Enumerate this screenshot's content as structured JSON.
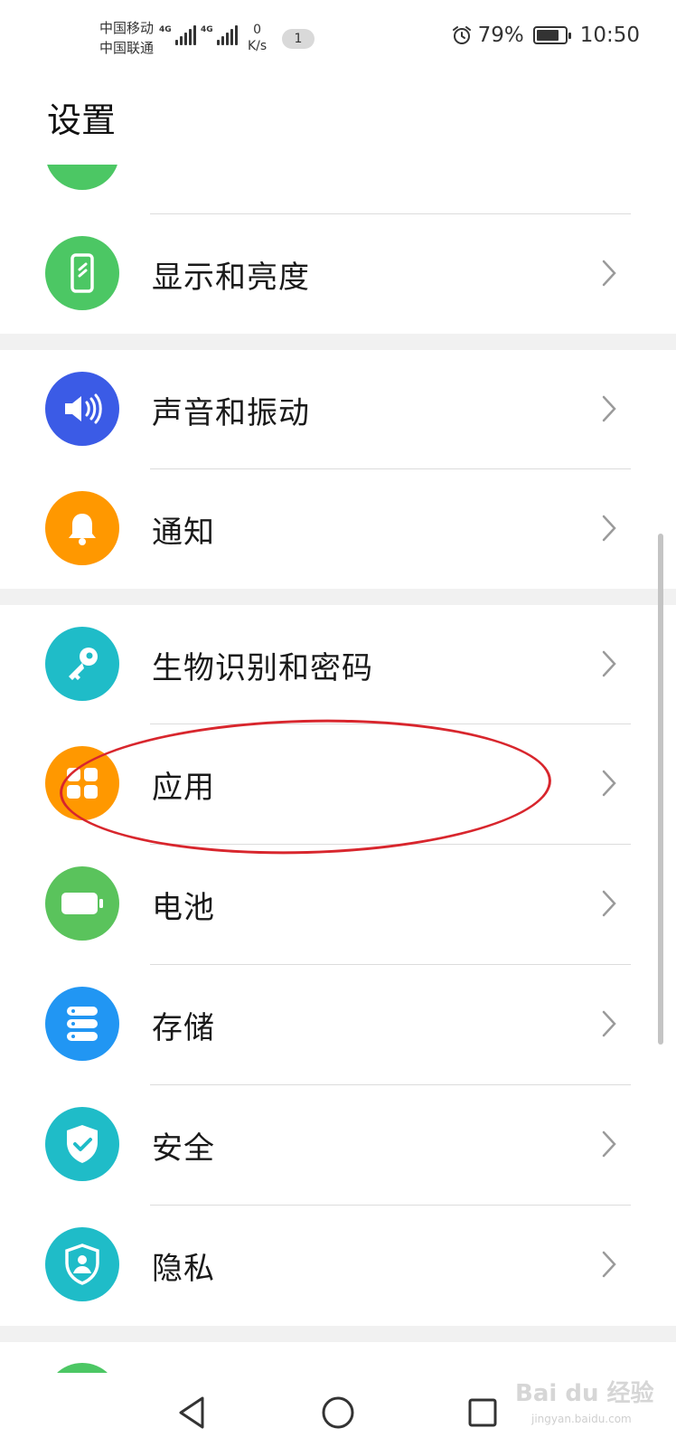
{
  "status_bar": {
    "carrier_1": "中国移动",
    "carrier_2": "中国联通",
    "network_1": "4G",
    "network_2": "4G",
    "speed_value": "0",
    "speed_unit": "K/s",
    "notification_count": "1",
    "battery_percent": "79%",
    "battery_level": 0.79,
    "time": "10:50"
  },
  "header": {
    "title": "设置"
  },
  "settings": {
    "items": [
      {
        "label": "显示和亮度",
        "icon": "display-icon",
        "color": "#4cc764"
      },
      {
        "label": "声音和振动",
        "icon": "speaker-icon",
        "color": "#3b5be6"
      },
      {
        "label": "通知",
        "icon": "bell-icon",
        "color": "#ff9800"
      },
      {
        "label": "生物识别和密码",
        "icon": "key-icon",
        "color": "#1fbcc8"
      },
      {
        "label": "应用",
        "icon": "apps-grid-icon",
        "color": "#ff9800"
      },
      {
        "label": "电池",
        "icon": "battery-icon",
        "color": "#5ac35c"
      },
      {
        "label": "存储",
        "icon": "storage-icon",
        "color": "#2196f3"
      },
      {
        "label": "安全",
        "icon": "shield-check-icon",
        "color": "#1fbcc8"
      },
      {
        "label": "隐私",
        "icon": "privacy-shield-icon",
        "color": "#1fbcc8"
      }
    ]
  },
  "nav_bar": {
    "back": "back-icon",
    "home": "home-icon",
    "recents": "recents-icon"
  },
  "watermark": {
    "brand": "Bai du 经验",
    "url": "jingyan.baidu.com"
  }
}
